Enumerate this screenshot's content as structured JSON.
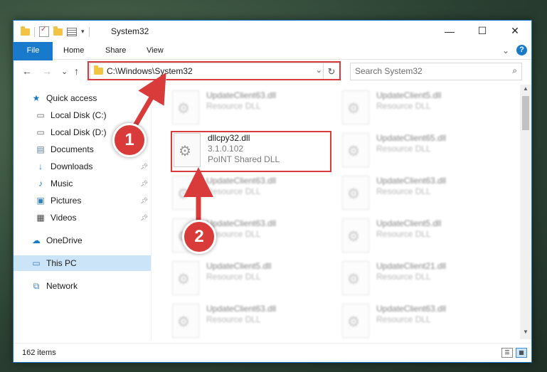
{
  "window": {
    "title": "System32",
    "controls": {
      "minimize": "—",
      "maximize": "☐",
      "close": "✕"
    }
  },
  "ribbon": {
    "tabs": [
      "File",
      "Home",
      "Share",
      "View"
    ],
    "collapse": "⌄",
    "help": "?"
  },
  "nav": {
    "back": "←",
    "forward": "→",
    "recent": "⌄",
    "up": "↑",
    "address": "C:\\Windows\\System32",
    "address_chevron": "⌄",
    "refresh": "↻",
    "search_placeholder": "Search System32"
  },
  "sidebar": {
    "items": [
      {
        "label": "Quick access",
        "icon": "star-icon"
      },
      {
        "label": "Local Disk (C:)",
        "icon": "drive-icon"
      },
      {
        "label": "Local Disk (D:)",
        "icon": "drive-icon"
      },
      {
        "label": "Documents",
        "icon": "documents-icon"
      },
      {
        "label": "Downloads",
        "icon": "download-icon"
      },
      {
        "label": "Music",
        "icon": "music-icon"
      },
      {
        "label": "Pictures",
        "icon": "pictures-icon"
      },
      {
        "label": "Videos",
        "icon": "videos-icon"
      },
      {
        "label": "OneDrive",
        "icon": "cloud-icon"
      },
      {
        "label": "This PC",
        "icon": "computer-icon"
      },
      {
        "label": "Network",
        "icon": "network-icon"
      }
    ]
  },
  "files": {
    "highlighted": {
      "name": "dllcpy32.dll",
      "version": "3.1.0.102",
      "description": "PoINT Shared DLL"
    },
    "blurred": [
      {
        "name": "UpdateClient63.dll",
        "type": "Resource DLL"
      },
      {
        "name": "UpdateClient5.dll",
        "type": "Resource DLL"
      },
      {
        "name": "UpdateClient65.dll",
        "type": "Resource DLL"
      },
      {
        "name": "UpdateClient63.dll",
        "type": "Resource DLL"
      },
      {
        "name": "UpdateClient63.dll",
        "type": "Resource DLL"
      },
      {
        "name": "UpdateClient63.dll",
        "type": "Resource DLL"
      },
      {
        "name": "UpdateClient5.dll",
        "type": "Resource DLL"
      },
      {
        "name": "UpdateClient5.dll",
        "type": "Resource DLL"
      },
      {
        "name": "UpdateClient21.dll",
        "type": "Resource DLL"
      },
      {
        "name": "UpdateClient63.dll",
        "type": "Resource DLL"
      },
      {
        "name": "UpdateClient63.dll",
        "type": "Resource DLL"
      }
    ]
  },
  "status": {
    "item_count": "162 items"
  },
  "annotations": {
    "step1": "1",
    "step2": "2",
    "color": "#d93a3a"
  }
}
